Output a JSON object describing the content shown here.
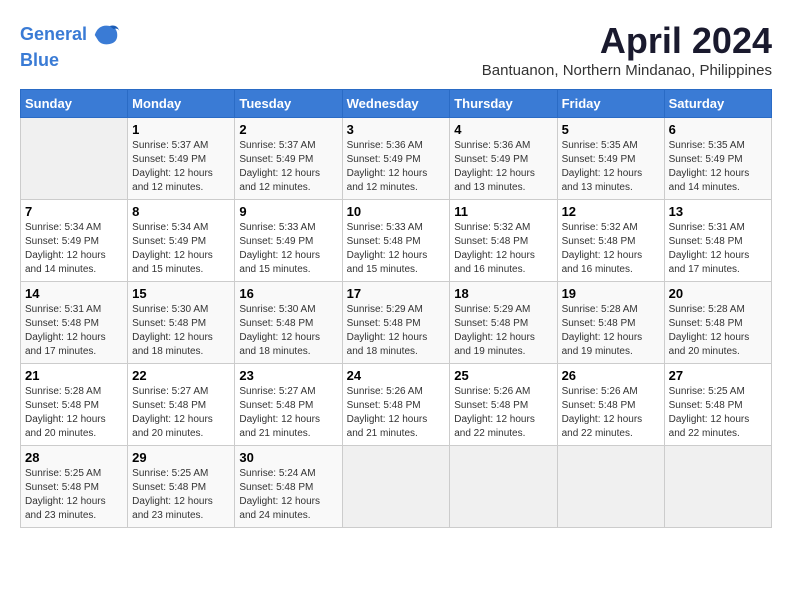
{
  "logo": {
    "line1": "General",
    "line2": "Blue"
  },
  "title": "April 2024",
  "subtitle": "Bantuanon, Northern Mindanao, Philippines",
  "days_of_week": [
    "Sunday",
    "Monday",
    "Tuesday",
    "Wednesday",
    "Thursday",
    "Friday",
    "Saturday"
  ],
  "weeks": [
    [
      {
        "num": "",
        "info": ""
      },
      {
        "num": "1",
        "info": "Sunrise: 5:37 AM\nSunset: 5:49 PM\nDaylight: 12 hours\nand 12 minutes."
      },
      {
        "num": "2",
        "info": "Sunrise: 5:37 AM\nSunset: 5:49 PM\nDaylight: 12 hours\nand 12 minutes."
      },
      {
        "num": "3",
        "info": "Sunrise: 5:36 AM\nSunset: 5:49 PM\nDaylight: 12 hours\nand 12 minutes."
      },
      {
        "num": "4",
        "info": "Sunrise: 5:36 AM\nSunset: 5:49 PM\nDaylight: 12 hours\nand 13 minutes."
      },
      {
        "num": "5",
        "info": "Sunrise: 5:35 AM\nSunset: 5:49 PM\nDaylight: 12 hours\nand 13 minutes."
      },
      {
        "num": "6",
        "info": "Sunrise: 5:35 AM\nSunset: 5:49 PM\nDaylight: 12 hours\nand 14 minutes."
      }
    ],
    [
      {
        "num": "7",
        "info": "Sunrise: 5:34 AM\nSunset: 5:49 PM\nDaylight: 12 hours\nand 14 minutes."
      },
      {
        "num": "8",
        "info": "Sunrise: 5:34 AM\nSunset: 5:49 PM\nDaylight: 12 hours\nand 15 minutes."
      },
      {
        "num": "9",
        "info": "Sunrise: 5:33 AM\nSunset: 5:49 PM\nDaylight: 12 hours\nand 15 minutes."
      },
      {
        "num": "10",
        "info": "Sunrise: 5:33 AM\nSunset: 5:48 PM\nDaylight: 12 hours\nand 15 minutes."
      },
      {
        "num": "11",
        "info": "Sunrise: 5:32 AM\nSunset: 5:48 PM\nDaylight: 12 hours\nand 16 minutes."
      },
      {
        "num": "12",
        "info": "Sunrise: 5:32 AM\nSunset: 5:48 PM\nDaylight: 12 hours\nand 16 minutes."
      },
      {
        "num": "13",
        "info": "Sunrise: 5:31 AM\nSunset: 5:48 PM\nDaylight: 12 hours\nand 17 minutes."
      }
    ],
    [
      {
        "num": "14",
        "info": "Sunrise: 5:31 AM\nSunset: 5:48 PM\nDaylight: 12 hours\nand 17 minutes."
      },
      {
        "num": "15",
        "info": "Sunrise: 5:30 AM\nSunset: 5:48 PM\nDaylight: 12 hours\nand 18 minutes."
      },
      {
        "num": "16",
        "info": "Sunrise: 5:30 AM\nSunset: 5:48 PM\nDaylight: 12 hours\nand 18 minutes."
      },
      {
        "num": "17",
        "info": "Sunrise: 5:29 AM\nSunset: 5:48 PM\nDaylight: 12 hours\nand 18 minutes."
      },
      {
        "num": "18",
        "info": "Sunrise: 5:29 AM\nSunset: 5:48 PM\nDaylight: 12 hours\nand 19 minutes."
      },
      {
        "num": "19",
        "info": "Sunrise: 5:28 AM\nSunset: 5:48 PM\nDaylight: 12 hours\nand 19 minutes."
      },
      {
        "num": "20",
        "info": "Sunrise: 5:28 AM\nSunset: 5:48 PM\nDaylight: 12 hours\nand 20 minutes."
      }
    ],
    [
      {
        "num": "21",
        "info": "Sunrise: 5:28 AM\nSunset: 5:48 PM\nDaylight: 12 hours\nand 20 minutes."
      },
      {
        "num": "22",
        "info": "Sunrise: 5:27 AM\nSunset: 5:48 PM\nDaylight: 12 hours\nand 20 minutes."
      },
      {
        "num": "23",
        "info": "Sunrise: 5:27 AM\nSunset: 5:48 PM\nDaylight: 12 hours\nand 21 minutes."
      },
      {
        "num": "24",
        "info": "Sunrise: 5:26 AM\nSunset: 5:48 PM\nDaylight: 12 hours\nand 21 minutes."
      },
      {
        "num": "25",
        "info": "Sunrise: 5:26 AM\nSunset: 5:48 PM\nDaylight: 12 hours\nand 22 minutes."
      },
      {
        "num": "26",
        "info": "Sunrise: 5:26 AM\nSunset: 5:48 PM\nDaylight: 12 hours\nand 22 minutes."
      },
      {
        "num": "27",
        "info": "Sunrise: 5:25 AM\nSunset: 5:48 PM\nDaylight: 12 hours\nand 22 minutes."
      }
    ],
    [
      {
        "num": "28",
        "info": "Sunrise: 5:25 AM\nSunset: 5:48 PM\nDaylight: 12 hours\nand 23 minutes."
      },
      {
        "num": "29",
        "info": "Sunrise: 5:25 AM\nSunset: 5:48 PM\nDaylight: 12 hours\nand 23 minutes."
      },
      {
        "num": "30",
        "info": "Sunrise: 5:24 AM\nSunset: 5:48 PM\nDaylight: 12 hours\nand 24 minutes."
      },
      {
        "num": "",
        "info": ""
      },
      {
        "num": "",
        "info": ""
      },
      {
        "num": "",
        "info": ""
      },
      {
        "num": "",
        "info": ""
      }
    ]
  ]
}
